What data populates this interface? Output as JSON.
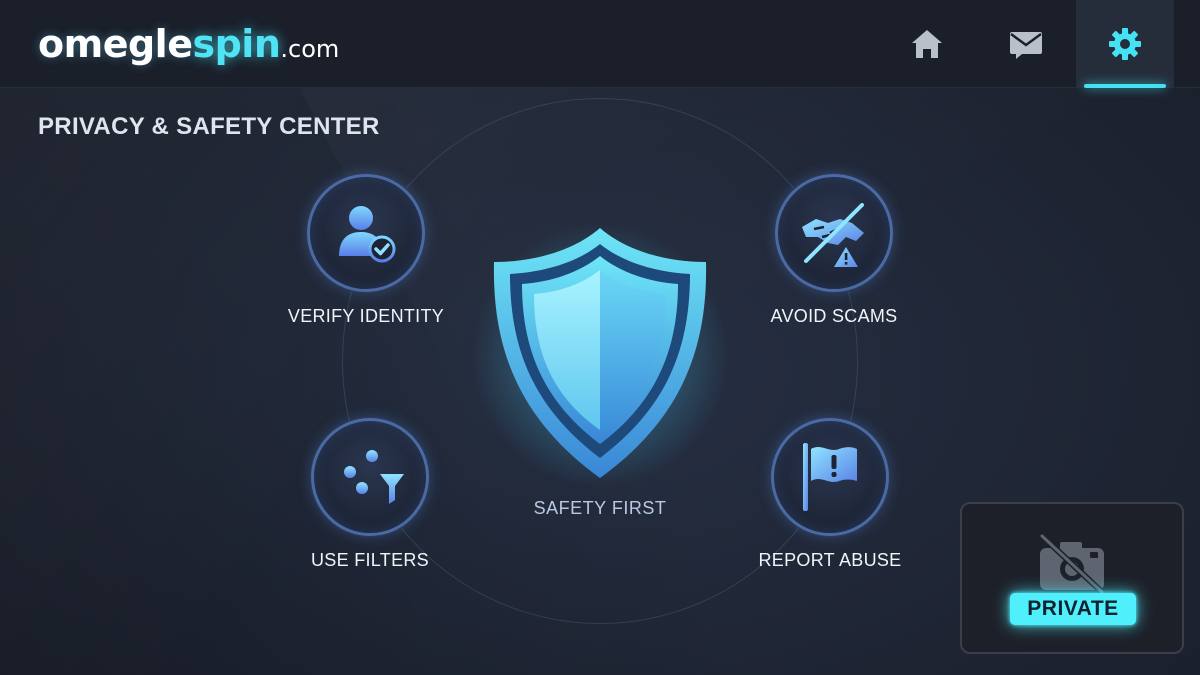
{
  "app": {
    "logo_part1": "omegle",
    "logo_part2": "spin",
    "logo_part3": ".com"
  },
  "nav": {
    "items": [
      {
        "icon": "home-icon",
        "active": false
      },
      {
        "icon": "mail-icon",
        "active": false
      },
      {
        "icon": "gear-icon",
        "active": true
      }
    ]
  },
  "page": {
    "title": "PRIVACY & SAFETY CENTER"
  },
  "features": [
    {
      "label": "VERIFY IDENTITY",
      "icon": "user-verified-icon"
    },
    {
      "label": "AVOID SCAMS",
      "icon": "no-handshake-warning-icon"
    },
    {
      "label": "USE FILTERS",
      "icon": "filter-sliders-icon"
    },
    {
      "label": "REPORT ABUSE",
      "icon": "report-flag-icon"
    }
  ],
  "center": {
    "caption": "SAFETY FIRST",
    "icon": "shield-icon"
  },
  "preview": {
    "badge": "PRIVATE",
    "icon": "camera-off-icon"
  },
  "colors": {
    "accent": "#4fe3f3",
    "background": "#202634",
    "header": "#1a1f2a"
  }
}
